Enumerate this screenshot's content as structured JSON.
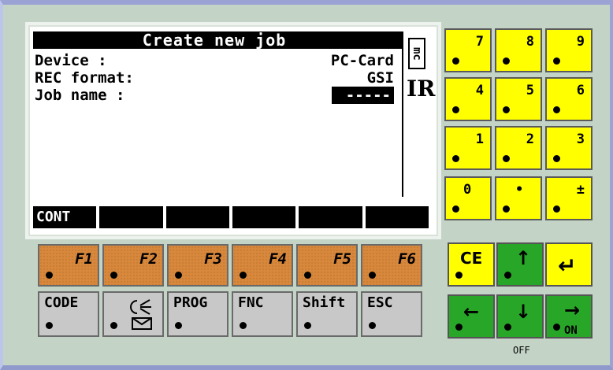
{
  "screen": {
    "title": "Create new job",
    "rows": [
      {
        "label": "Device    :",
        "value": "PC-Card"
      },
      {
        "label": "REC format:",
        "value": "GSI"
      },
      {
        "label": "Job name  :",
        "value": "-----"
      }
    ],
    "side_badge": "mc",
    "side_text": "IR",
    "softkeys": [
      "CONT",
      "",
      "",
      "",
      "",
      ""
    ]
  },
  "keypad": [
    "7",
    "8",
    "9",
    "4",
    "5",
    "6",
    "1",
    "2",
    "3",
    "0",
    "•",
    "±"
  ],
  "fkeys": [
    "F1",
    "F2",
    "F3",
    "F4",
    "F5",
    "F6"
  ],
  "gkeys": [
    "CODE",
    "",
    "PROG",
    "FNC",
    "Shift",
    "ESC"
  ],
  "nav": {
    "ce": "CE",
    "up": "↑",
    "enter": "↵",
    "left": "←",
    "down": "↓",
    "on_arrow": "→",
    "on_label": "ON",
    "off_label": "OFF"
  },
  "colors": {
    "numeric_keys": "#ffff00",
    "function_keys": "#d7883d",
    "grey_keys": "#c8c8c8",
    "green_keys": "#28a628",
    "body": "#c3d4c6"
  }
}
